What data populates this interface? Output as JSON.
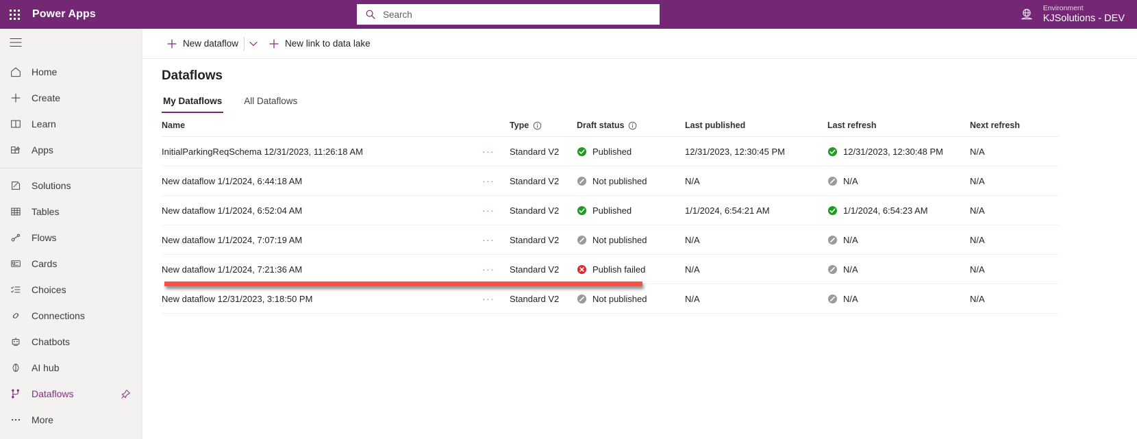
{
  "topbar": {
    "waffle_name": "app-launcher",
    "brand": "Power Apps",
    "search": {
      "placeholder": "Search",
      "value": ""
    },
    "environment": {
      "label": "Environment",
      "name": "KJSolutions - DEV"
    }
  },
  "sidebar": {
    "hamburger": "hamburger-menu",
    "items": [
      {
        "label": "Home",
        "icon": "home-icon",
        "selected": false
      },
      {
        "label": "Create",
        "icon": "plus-icon",
        "selected": false
      },
      {
        "label": "Learn",
        "icon": "book-icon",
        "selected": false
      },
      {
        "label": "Apps",
        "icon": "apps-icon",
        "selected": false
      },
      {
        "label": "Solutions",
        "icon": "solutions-icon",
        "selected": false
      },
      {
        "label": "Tables",
        "icon": "table-icon",
        "selected": false
      },
      {
        "label": "Flows",
        "icon": "flows-icon",
        "selected": false
      },
      {
        "label": "Cards",
        "icon": "cards-icon",
        "selected": false
      },
      {
        "label": "Choices",
        "icon": "choices-icon",
        "selected": false
      },
      {
        "label": "Connections",
        "icon": "connections-icon",
        "selected": false
      },
      {
        "label": "Chatbots",
        "icon": "robot-icon",
        "selected": false
      },
      {
        "label": "AI hub",
        "icon": "ai-brain-icon",
        "selected": false
      },
      {
        "label": "Dataflows",
        "icon": "dataflows-icon",
        "selected": true,
        "pinned": true
      },
      {
        "label": "More",
        "icon": "ellipsis-icon",
        "selected": false
      }
    ]
  },
  "commandbar": {
    "new_dataflow": "New dataflow",
    "split_caret": "chevron-down-icon",
    "new_link": "New link to data lake"
  },
  "main": {
    "title": "Dataflows",
    "tabs": [
      {
        "label": "My Dataflows",
        "active": true
      },
      {
        "label": "All Dataflows",
        "active": false
      }
    ],
    "table": {
      "columns": [
        {
          "label": "Name",
          "info": false
        },
        {
          "label": "",
          "info": false
        },
        {
          "label": "Type",
          "info": true
        },
        {
          "label": "Draft status",
          "info": true
        },
        {
          "label": "Last published",
          "info": false
        },
        {
          "label": "Last refresh",
          "info": false
        },
        {
          "label": "Next refresh",
          "info": false
        }
      ],
      "rows": [
        {
          "name": "InitialParkingReqSchema 12/31/2023, 11:26:18 AM",
          "overflow": "···",
          "type": "Standard V2",
          "draft_status": "Published",
          "draft_icon": "published-check-icon",
          "last_published": "12/31/2023, 12:30:45 PM",
          "last_refresh": "12/31/2023, 12:30:48 PM",
          "refresh_icon": "published-check-icon",
          "next_refresh": "N/A"
        },
        {
          "name": "New dataflow 1/1/2024, 6:44:18 AM",
          "overflow": "···",
          "type": "Standard V2",
          "draft_status": "Not published",
          "draft_icon": "not-published-slash-icon",
          "last_published": "N/A",
          "last_refresh": "N/A",
          "refresh_icon": "not-published-slash-icon",
          "next_refresh": "N/A"
        },
        {
          "name": "New dataflow 1/1/2024, 6:52:04 AM",
          "overflow": "···",
          "type": "Standard V2",
          "draft_status": "Published",
          "draft_icon": "published-check-icon",
          "last_published": "1/1/2024, 6:54:21 AM",
          "last_refresh": "1/1/2024, 6:54:23 AM",
          "refresh_icon": "published-check-icon",
          "next_refresh": "N/A"
        },
        {
          "name": "New dataflow 1/1/2024, 7:07:19 AM",
          "overflow": "···",
          "type": "Standard V2",
          "draft_status": "Not published",
          "draft_icon": "not-published-slash-icon",
          "last_published": "N/A",
          "last_refresh": "N/A",
          "refresh_icon": "not-published-slash-icon",
          "next_refresh": "N/A"
        },
        {
          "name": "New dataflow 1/1/2024, 7:21:36 AM",
          "overflow": "···",
          "type": "Standard V2",
          "draft_status": "Publish failed",
          "draft_icon": "publish-failed-error-icon",
          "last_published": "N/A",
          "last_refresh": "N/A",
          "refresh_icon": "not-published-slash-icon",
          "next_refresh": "N/A"
        },
        {
          "name": "New dataflow 12/31/2023, 3:18:50 PM",
          "overflow": "···",
          "type": "Standard V2",
          "draft_status": "Not published",
          "draft_icon": "not-published-slash-icon",
          "last_published": "N/A",
          "last_refresh": "N/A",
          "refresh_icon": "not-published-slash-icon",
          "next_refresh": "N/A"
        }
      ]
    }
  },
  "annotation": {
    "color": "#fb4f45",
    "target_row_index": 4
  },
  "colors": {
    "brand_purple": "#742774",
    "accent_purple": "#8a2a8a",
    "success_green": "#107c10",
    "neutral_gray": "#8a8886",
    "error_red": "#d13438",
    "annotation_red": "#fb4f45"
  }
}
